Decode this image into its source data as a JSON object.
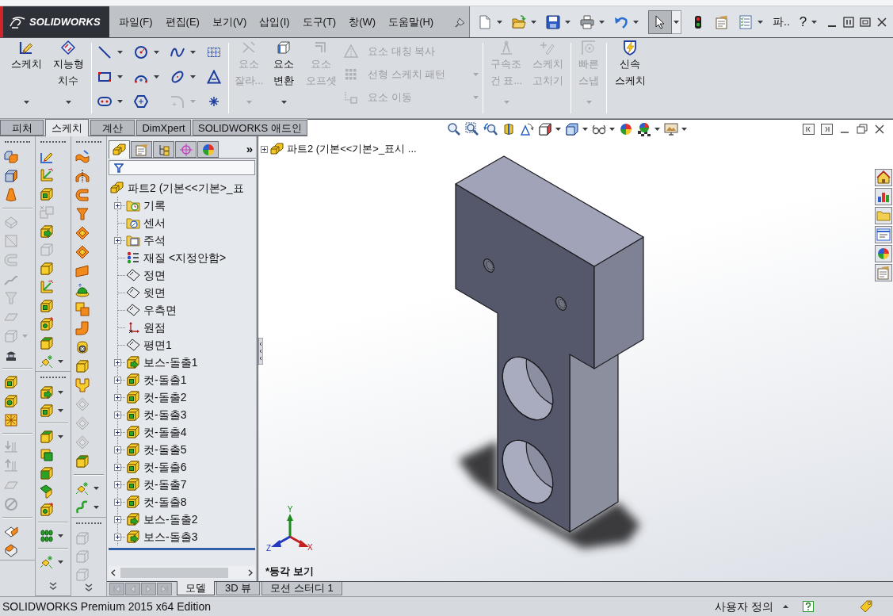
{
  "title_bar": {
    "logo": "SOLIDWORKS",
    "menu": [
      "파일(F)",
      "편집(E)",
      "보기(V)",
      "삽입(I)",
      "도구(T)",
      "창(W)",
      "도움말(H)"
    ]
  },
  "quick_access": {
    "select_pressed": true,
    "search_label": "파..",
    "help_label": "?"
  },
  "ribbon": {
    "main_buttons": [
      {
        "label": "스케치",
        "disabled": false
      },
      {
        "label": "지능형\n치수",
        "disabled": false
      }
    ],
    "sketch_tools": [
      {
        "disabled": false
      },
      {
        "disabled": false
      },
      {
        "disabled": false
      },
      {
        "disabled": false
      },
      {
        "disabled": false
      },
      {
        "disabled": false
      },
      {
        "disabled": false
      },
      {
        "disabled": false
      },
      {
        "disabled": false
      },
      {
        "disabled": false
      },
      {
        "disabled": true
      },
      {
        "disabled": false
      }
    ],
    "entity_buttons": [
      {
        "label": "요소\n잘라...",
        "disabled": true
      },
      {
        "label": "요소\n변환",
        "disabled": false
      },
      {
        "label": "요소\n오프셋",
        "disabled": true
      }
    ],
    "entity_list": [
      {
        "label": "요소 대칭 복사",
        "disabled": true
      },
      {
        "label": "선형 스케치 패턴",
        "disabled": true
      },
      {
        "label": "요소 이동",
        "disabled": true
      }
    ],
    "relation_buttons": [
      {
        "label": "구속조\n건 표...",
        "disabled": true
      },
      {
        "label": "스케치\n고치기",
        "disabled": true
      }
    ],
    "snap_button": {
      "label": "빠른\n스냅",
      "disabled": true
    },
    "rapid_sketch_button": {
      "label": "신속\n스케치",
      "disabled": false
    }
  },
  "command_tabs": [
    {
      "label": "피처",
      "selected": false
    },
    {
      "label": "스케치",
      "selected": true
    },
    {
      "label": "계산",
      "selected": false
    },
    {
      "label": "DimXpert",
      "selected": false
    },
    {
      "label": "SOLIDWORKS 애드인",
      "selected": false
    }
  ],
  "command_toolbars": [
    {
      "toolbars": [
        {
          "groups": [
            [
              {
                "disabled": false
              },
              {
                "disabled": false
              },
              {
                "disabled": false
              }
            ],
            [
              {
                "disabled": true
              },
              {
                "disabled": true
              },
              {
                "disabled": true
              },
              {
                "disabled": true
              },
              {
                "disabled": true
              },
              {
                "disabled": true
              },
              {
                "disabled": true
              },
              {
                "disabled": false
              }
            ],
            [
              {
                "disabled": false
              },
              {
                "disabled": false
              },
              {
                "disabled": false
              }
            ],
            [
              {
                "disabled": true
              },
              {
                "disabled": true
              },
              {
                "disabled": true
              },
              {
                "disabled": true
              }
            ],
            [
              {
                "disabled": false
              },
              {
                "disabled": false
              }
            ]
          ]
        }
      ]
    },
    {
      "toolbars": [
        {
          "groups": [
            [
              {
                "disabled": false
              },
              {
                "disabled": false
              },
              {
                "disabled": false
              },
              {
                "disabled": true
              },
              {
                "disabled": false
              },
              {
                "disabled": true
              },
              {
                "disabled": false
              },
              {
                "disabled": false
              },
              {
                "disabled": false
              },
              {
                "disabled": false
              },
              {
                "disabled": false
              },
              {
                "disabled": false
              }
            ]
          ]
        },
        {
          "groups": [
            [
              {
                "disabled": false
              },
              {
                "disabled": false
              }
            ],
            [
              {
                "disabled": false
              },
              {
                "disabled": false
              },
              {
                "disabled": false
              },
              {
                "disabled": false
              },
              {
                "disabled": false
              }
            ],
            [
              {
                "disabled": false
              }
            ],
            [
              {
                "disabled": false
              }
            ]
          ]
        }
      ]
    },
    {
      "toolbars": [
        {
          "groups": [
            [
              {
                "disabled": false
              },
              {
                "disabled": false
              },
              {
                "disabled": false
              },
              {
                "disabled": false
              },
              {
                "disabled": false
              },
              {
                "disabled": false
              },
              {
                "disabled": false
              },
              {
                "disabled": false
              },
              {
                "disabled": false
              },
              {
                "disabled": false
              },
              {
                "disabled": false
              },
              {
                "disabled": false
              },
              {
                "disabled": false
              },
              {
                "disabled": true
              },
              {
                "disabled": true
              },
              {
                "disabled": true
              },
              {
                "disabled": false
              }
            ],
            [
              {
                "disabled": false
              },
              {
                "disabled": false
              }
            ]
          ]
        },
        {
          "groups": [
            [
              {
                "disabled": true
              },
              {
                "disabled": true
              },
              {
                "disabled": true
              }
            ]
          ]
        }
      ]
    }
  ],
  "feature_tree": {
    "panel_tabs": [
      {
        "selected": true
      },
      {
        "selected": false
      },
      {
        "selected": false
      },
      {
        "selected": false
      },
      {
        "selected": false
      }
    ],
    "more_label": "»",
    "root": "파트2 (기본<<기본>_표",
    "items": [
      {
        "label": "기록",
        "kind": "history",
        "expanded": false
      },
      {
        "label": "센서",
        "kind": "sensor"
      },
      {
        "label": "주석",
        "kind": "annotation",
        "expanded": false
      },
      {
        "label": "재질 <지정안함>",
        "kind": "material"
      },
      {
        "label": "정면",
        "kind": "plane"
      },
      {
        "label": "윗면",
        "kind": "plane"
      },
      {
        "label": "우측면",
        "kind": "plane"
      },
      {
        "label": "원점",
        "kind": "origin"
      },
      {
        "label": "평면1",
        "kind": "plane"
      },
      {
        "label": "보스-돌출1",
        "kind": "boss",
        "expanded": false
      },
      {
        "label": "컷-돌출1",
        "kind": "cut",
        "expanded": false
      },
      {
        "label": "컷-돌출2",
        "kind": "cut",
        "expanded": false
      },
      {
        "label": "컷-돌출3",
        "kind": "cut",
        "expanded": false
      },
      {
        "label": "컷-돌출4",
        "kind": "cut",
        "expanded": false
      },
      {
        "label": "컷-돌출5",
        "kind": "cut",
        "expanded": false
      },
      {
        "label": "컷-돌출6",
        "kind": "cut",
        "expanded": false
      },
      {
        "label": "컷-돌출7",
        "kind": "cut",
        "expanded": false
      },
      {
        "label": "컷-돌출8",
        "kind": "cut",
        "expanded": false
      },
      {
        "label": "보스-돌출2",
        "kind": "boss",
        "expanded": false
      },
      {
        "label": "보스-돌출3",
        "kind": "boss",
        "expanded": false
      }
    ]
  },
  "graphics_area": {
    "tree_flyout": {
      "label": "파트2  (기본<<기본>_표시 ...",
      "expanded": false
    },
    "triad": {
      "x": "X",
      "y": "Y",
      "z": "Z"
    },
    "view_name": "*등각 보기"
  },
  "bottom_tabs": [
    {
      "label": "모델",
      "selected": true
    },
    {
      "label": "3D 뷰",
      "selected": false
    },
    {
      "label": "모션 스터디 1",
      "selected": false
    }
  ],
  "status_bar": {
    "edition": "SOLIDWORKS Premium 2015 x64 Edition",
    "units": "사용자 정의"
  }
}
